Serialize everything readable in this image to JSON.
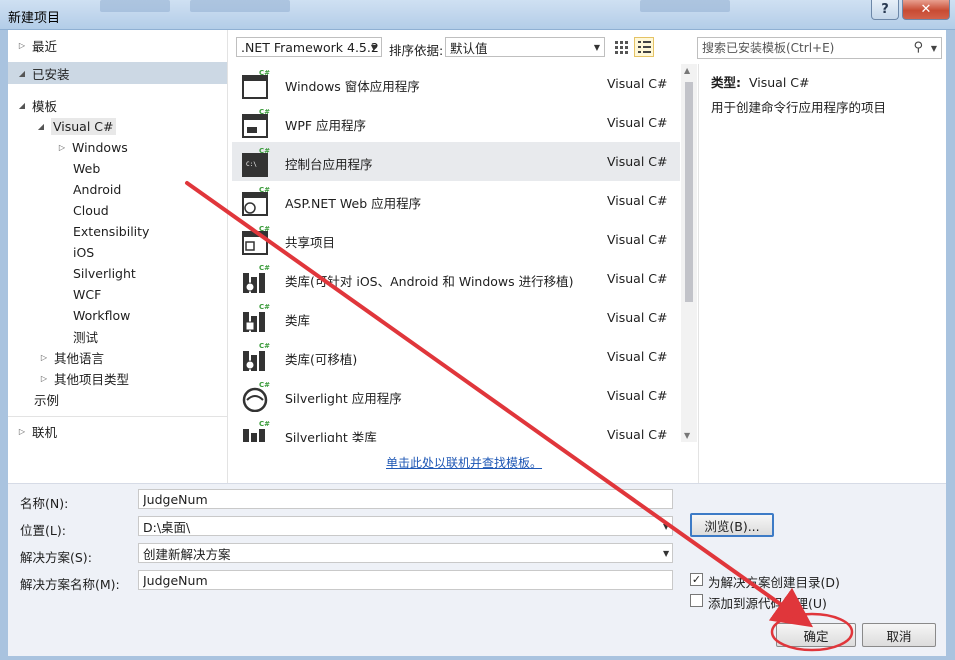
{
  "window": {
    "title": "新建项目",
    "help": "?",
    "close": "✕"
  },
  "sidebar": {
    "installed": "已安装",
    "templates": "模板",
    "visual_csharp": "Visual C#",
    "children": [
      "Windows",
      "Web",
      "Android",
      "Cloud",
      "Extensibility",
      "iOS",
      "Silverlight",
      "WCF",
      "Workflow",
      "测试"
    ],
    "other_languages": "其他语言",
    "other_project_types": "其他项目类型",
    "samples": "示例",
    "online": "联机"
  },
  "toolbar": {
    "framework": ".NET Framework 4.5.2",
    "sort_label": "排序依据:",
    "sort_value": "默认值",
    "search_placeholder": "搜索已安装模板(Ctrl+E)"
  },
  "templates": [
    {
      "name": "Windows 窗体应用程序",
      "lang": "Visual C#"
    },
    {
      "name": "WPF 应用程序",
      "lang": "Visual C#"
    },
    {
      "name": "控制台应用程序",
      "lang": "Visual C#"
    },
    {
      "name": "ASP.NET Web 应用程序",
      "lang": "Visual C#"
    },
    {
      "name": "共享项目",
      "lang": "Visual C#"
    },
    {
      "name": "类库(可针对 iOS、Android 和 Windows 进行移植)",
      "lang": "Visual C#"
    },
    {
      "name": "类库",
      "lang": "Visual C#"
    },
    {
      "name": "类库(可移植)",
      "lang": "Visual C#"
    },
    {
      "name": "Silverlight 应用程序",
      "lang": "Visual C#"
    },
    {
      "name": "Silverlight 类库",
      "lang": "Visual C#"
    }
  ],
  "online_link": "单击此处以联机并查找模板。",
  "info": {
    "type_label": "类型:",
    "type_value": "Visual C#",
    "description": "用于创建命令行应用程序的项目"
  },
  "form": {
    "name_label": "名称(N):",
    "name_value": "JudgeNum",
    "location_label": "位置(L):",
    "location_value": "D:\\桌面\\",
    "solution_label": "解决方案(S):",
    "solution_value": "创建新解决方案",
    "solution_name_label": "解决方案名称(M):",
    "solution_name_value": "JudgeNum",
    "browse": "浏览(B)...",
    "create_dir": "为解决方案创建目录(D)",
    "add_source_control": "添加到源代码管理(U)",
    "ok": "确定",
    "cancel": "取消"
  },
  "colors": {
    "accent": "#3d7bc6",
    "selected_item": "#e8eaed",
    "annotation": "#e0363b"
  }
}
